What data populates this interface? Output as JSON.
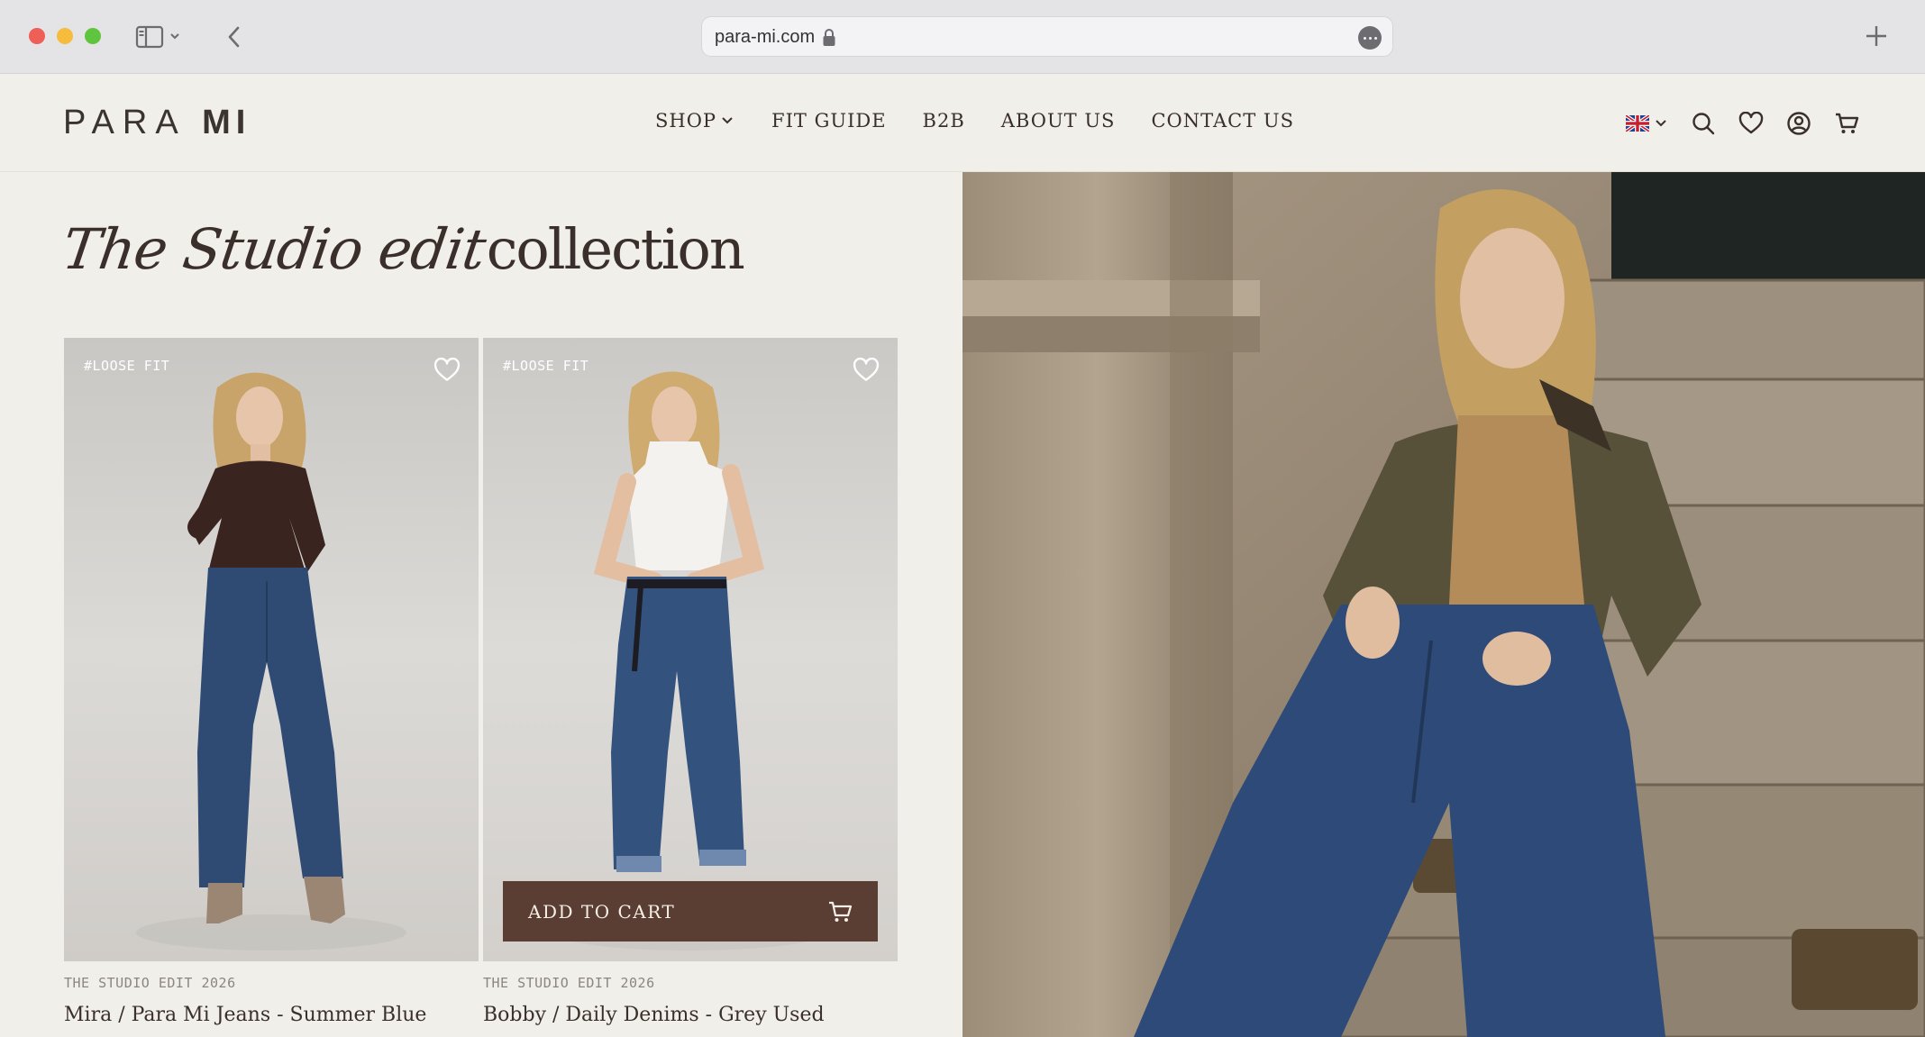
{
  "browser": {
    "url": "para-mi.com"
  },
  "site": {
    "logo_left": "PARA",
    "logo_right": "MI",
    "nav": [
      {
        "label": "SHOP"
      },
      {
        "label": "FIT GUIDE"
      },
      {
        "label": "B2B"
      },
      {
        "label": "ABOUT US"
      },
      {
        "label": "CONTACT US"
      }
    ],
    "language_flag": "uk-flag-icon"
  },
  "hero": {
    "title_script": "The Studio edit",
    "title_serif": "collection"
  },
  "products": [
    {
      "tag": "#LOOSE FIT",
      "collection": "THE STUDIO EDIT 2026",
      "name": "Mira / Para Mi Jeans - Summer Blue",
      "top_color": "#3a2420"
    },
    {
      "tag": "#LOOSE FIT",
      "collection": "THE STUDIO EDIT 2026",
      "name": "Bobby / Daily Denims - Grey Used",
      "top_color": "#f4f2ee",
      "cart_button": "ADD TO CART"
    }
  ],
  "colors": {
    "background": "#f1efe9",
    "brand_dark": "#5a3d33",
    "denim": "#2f4b73"
  }
}
